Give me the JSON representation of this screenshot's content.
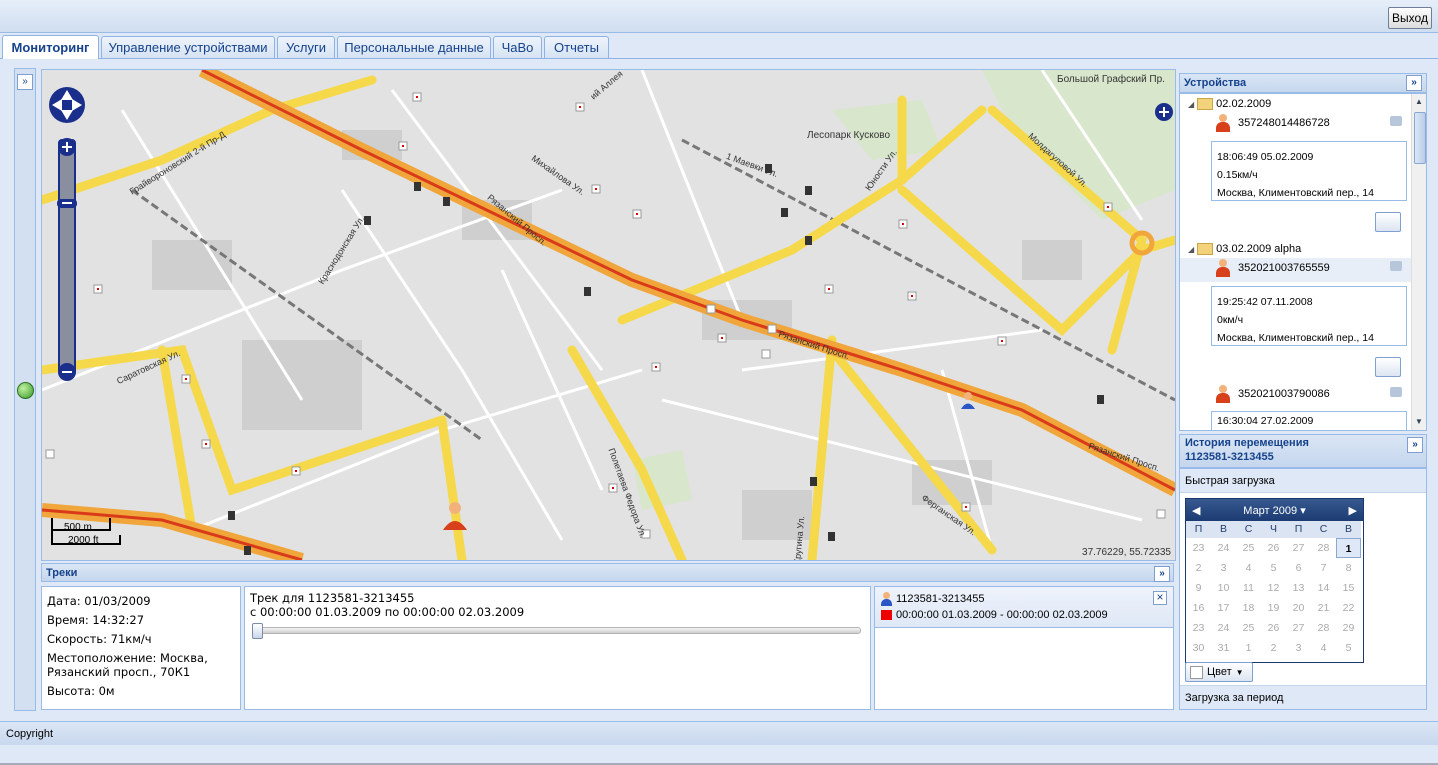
{
  "header": {
    "exit_label": "Выход"
  },
  "tabs": [
    {
      "label": "Мониторинг",
      "active": true
    },
    {
      "label": "Управление устройствами"
    },
    {
      "label": "Услуги"
    },
    {
      "label": "Персональные данные"
    },
    {
      "label": "ЧаВо"
    },
    {
      "label": "Отчеты"
    }
  ],
  "map": {
    "coords": "37.76229, 55.72335",
    "scale_m": "500 m",
    "scale_ft": "2000 ft",
    "labels": {
      "bolshoy": "Большой Графский Пр.",
      "lesopark": "Лесопарк Кусково",
      "yunosti": "Юности Ул.",
      "moldag": "Молдагуловой Ул.",
      "ryazan1": "Рязанский Просп.",
      "ryazan2": "Рязанский Просп.",
      "ryazan3": "Рязанский Просп.",
      "grayvoron": "Грайвороновский 2-й Пр-Д",
      "ferganskaya": "Ферганская Ул.",
      "poletaeva": "Полетаева Федора Ул.",
      "krasnodon": "Краснодонская Ул.",
      "saratov": "Саратовская Ул.",
      "krybina": "Кругина Ул.",
      "mayovka": "1 Маевки Ул.",
      "mikhailova": "Михайлова Ул.",
      "alleya": "ий Аллея"
    }
  },
  "tracks": {
    "title": "Треки",
    "info": {
      "date": "Дата: 01/03/2009",
      "time": "Время: 14:32:27",
      "speed": "Скорость: 71км/ч",
      "location": "Местоположение: Москва, Рязанский просп., 70К1",
      "altitude": "Высота: 0м"
    },
    "track_title": "Трек для 1123581-3213455",
    "track_range": "с 00:00:00 01.03.2009 по 00:00:00 02.03.2009",
    "slider_value": 0,
    "legend_device": "1123581-3213455",
    "legend_range": "00:00:00 01.03.2009 - 00:00:00 02.03.2009",
    "legend_color": "#ee0000"
  },
  "devices": {
    "title": "Устройства",
    "groups": [
      {
        "name": "02.02.2009",
        "device": "357248014486728",
        "time": "18:06:49 05.02.2009",
        "speed": "0.15км/ч",
        "address": "Москва, Климентовский пер., 14"
      },
      {
        "name": "03.02.2009 alpha",
        "device": "352021003765559",
        "time": "19:25:42 07.11.2008",
        "speed": "0км/ч",
        "address": "Москва, Климентовский пер., 14"
      }
    ],
    "extra_device": "352021003790086",
    "extra_time": "16:30:04 27.02.2009"
  },
  "history": {
    "title": "История перемещения",
    "device": "1123581-3213455",
    "fast_load": "Быстрая загрузка",
    "period_load": "Загрузка за период",
    "month": "Март 2009",
    "dow": [
      "П",
      "В",
      "С",
      "Ч",
      "П",
      "С",
      "В"
    ],
    "days": [
      [
        "23",
        "24",
        "25",
        "26",
        "27",
        "28",
        "1"
      ],
      [
        "2",
        "3",
        "4",
        "5",
        "6",
        "7",
        "8"
      ],
      [
        "9",
        "10",
        "11",
        "12",
        "13",
        "14",
        "15"
      ],
      [
        "16",
        "17",
        "18",
        "19",
        "20",
        "21",
        "22"
      ],
      [
        "23",
        "24",
        "25",
        "26",
        "27",
        "28",
        "29"
      ],
      [
        "30",
        "31",
        "1",
        "2",
        "3",
        "4",
        "5"
      ]
    ],
    "current_day": "1",
    "color_label": "Цвет"
  },
  "footer": {
    "copyright": "Copyright"
  }
}
